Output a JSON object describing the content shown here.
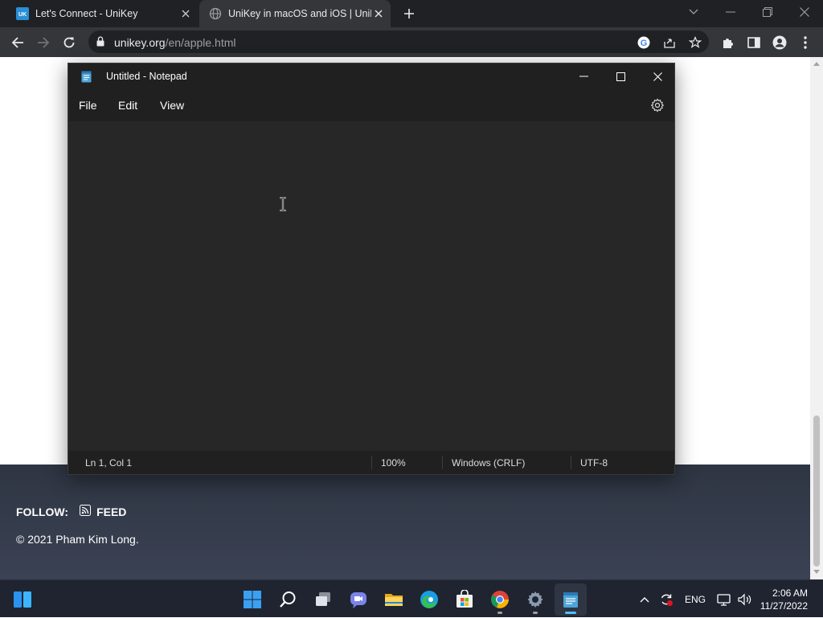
{
  "browser": {
    "tabs": [
      {
        "title": "Let's Connect - UniKey",
        "active": false,
        "favicon": "unikey-logo"
      },
      {
        "title": "UniKey in macOS and iOS | UniKey",
        "active": true,
        "favicon": "globe-icon"
      }
    ],
    "url_host": "unikey.org",
    "url_path": "/en/apple.html"
  },
  "page": {
    "follow_label": "FOLLOW:",
    "feed_label": "FEED",
    "copyright": "© 2021 Pham Kim Long."
  },
  "notepad": {
    "title": "Untitled - Notepad",
    "menu": [
      "File",
      "Edit",
      "View"
    ],
    "status": {
      "position": "Ln 1, Col 1",
      "zoom": "100%",
      "line_ending": "Windows (CRLF)",
      "encoding": "UTF-8"
    }
  },
  "taskbar": {
    "apps": [
      "start",
      "search",
      "task-view",
      "teams-chat",
      "file-explorer",
      "edge",
      "store",
      "chrome",
      "settings",
      "notepad"
    ],
    "language": "ENG",
    "time": "2:06 AM",
    "date": "11/27/2022"
  },
  "colors": {
    "browser_frame": "#202124",
    "browser_toolbar": "#35363a",
    "footer": "#2e3542",
    "notepad_bg": "#272727",
    "taskbar": "#1f2430",
    "accent": "#4cc2ff"
  }
}
